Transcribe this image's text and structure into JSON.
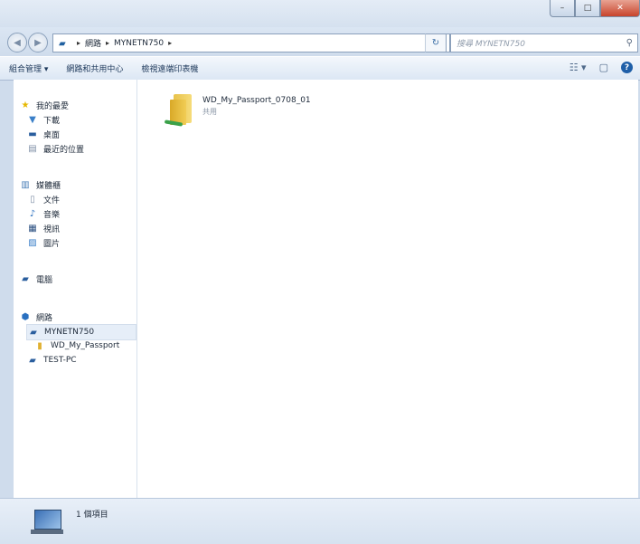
{
  "window": {
    "caption_buttons": {
      "minimize": "–",
      "maximize": "□",
      "close": "✕"
    }
  },
  "nav": {
    "back_glyph": "◀",
    "forward_glyph": "▶",
    "breadcrumbs": [
      "網路",
      "MYNETN750"
    ],
    "separator": "▸",
    "refresh_glyph": "↻",
    "search_placeholder": "搜尋 MYNETN750",
    "search_icon": "search-icon"
  },
  "toolbar": {
    "items": [
      "組合管理 ▾",
      "網路和共用中心",
      "檢視遠端印表機"
    ],
    "view_glyph": "☷ ▾",
    "pane_glyph": "▢",
    "help_glyph": "?"
  },
  "sidebar": {
    "items": [
      {
        "label": "我的最愛",
        "icon": "star-icon",
        "glyph": "★",
        "color": "#e6b800",
        "indent": 0
      },
      {
        "label": "下載",
        "icon": "download-folder-icon",
        "glyph": "▼",
        "color": "#3a7fc8",
        "indent": 1
      },
      {
        "label": "桌面",
        "icon": "desktop-icon",
        "glyph": "▬",
        "color": "#2a5e9e",
        "indent": 1
      },
      {
        "label": "最近的位置",
        "icon": "recent-places-icon",
        "glyph": "▤",
        "color": "#7d8ea5",
        "indent": 1
      },
      {
        "label": "媒體櫃",
        "icon": "library-icon",
        "glyph": "▥",
        "color": "#4a7fb8",
        "indent": 0
      },
      {
        "label": "文件",
        "icon": "documents-icon",
        "glyph": "▯",
        "color": "#7d8ea5",
        "indent": 1
      },
      {
        "label": "音樂",
        "icon": "music-icon",
        "glyph": "♪",
        "color": "#2a70c0",
        "indent": 1
      },
      {
        "label": "視訊",
        "icon": "video-icon",
        "glyph": "▦",
        "color": "#2a4f80",
        "indent": 1
      },
      {
        "label": "圖片",
        "icon": "pictures-icon",
        "glyph": "▨",
        "color": "#3a7fc8",
        "indent": 1
      },
      {
        "label": "電腦",
        "icon": "computer-icon",
        "glyph": "▰",
        "color": "#2a5e9e",
        "indent": 0
      },
      {
        "label": "網路",
        "icon": "network-icon",
        "glyph": "⬢",
        "color": "#2a70c0",
        "indent": 0
      },
      {
        "label": "MYNETN750",
        "icon": "network-device-icon",
        "glyph": "▰",
        "color": "#2a5e9e",
        "indent": 1,
        "selected": true
      },
      {
        "label": "WD_My_Passport",
        "icon": "shared-folder-icon",
        "glyph": "▮",
        "color": "#e0b030",
        "indent": 2
      },
      {
        "label": "TEST-PC",
        "icon": "computer-icon",
        "glyph": "▰",
        "color": "#2a5e9e",
        "indent": 1
      }
    ]
  },
  "content": {
    "files": [
      {
        "name": "WD_My_Passport_0708_01",
        "subtitle": "共用"
      }
    ]
  },
  "status": {
    "count_text": "1 個項目"
  }
}
